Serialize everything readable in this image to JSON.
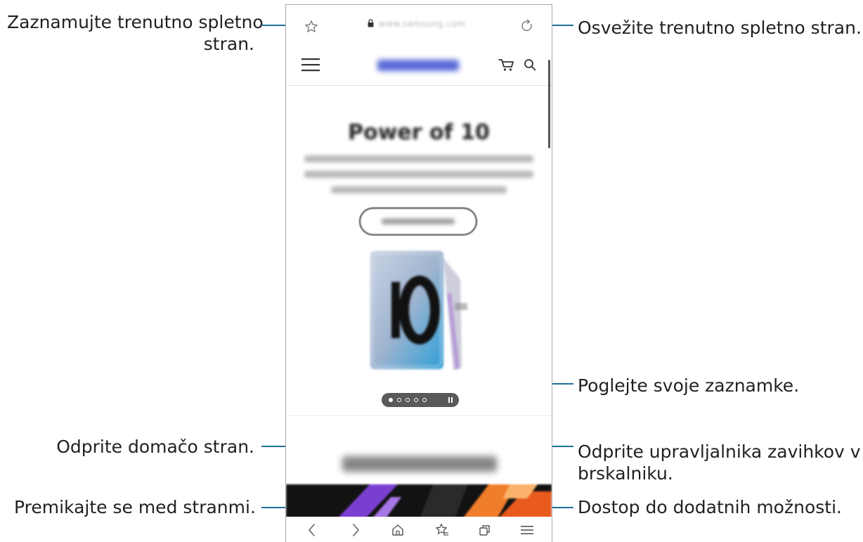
{
  "callouts": {
    "bookmark_current": [
      "Zaznamujte trenutno spletno",
      "stran."
    ],
    "refresh": "Osvežite trenutno spletno stran.",
    "view_bookmarks": "Poglejte svoje zaznamke.",
    "open_home": "Odprite domačo stran.",
    "tab_manager": [
      "Odprite upravljalnika zavihkov v",
      "brskalniku."
    ],
    "navigate_pages": "Premikajte se med stranmi.",
    "more_options": "Dostop do dodatnih možnosti."
  },
  "browser": {
    "url": "www.samsung.com",
    "site_title": "SAMSUNG",
    "hero_title": "Power of 10",
    "section_title": "Explore our Galaxy",
    "carousel": {
      "total": 5,
      "active_index": 0
    }
  },
  "icons": {
    "bookmark_star": "star-outline-icon",
    "lock": "lock-icon",
    "refresh": "refresh-icon",
    "menu": "hamburger-icon",
    "cart": "cart-icon",
    "search": "search-icon",
    "back": "chevron-left-icon",
    "forward": "chevron-right-icon",
    "home": "home-icon",
    "bookmarks": "bookmarks-icon",
    "tabs": "tabs-icon",
    "more": "more-menu-icon"
  },
  "colors": {
    "callout_line": "#1f6f9a",
    "text": "#231f20"
  }
}
